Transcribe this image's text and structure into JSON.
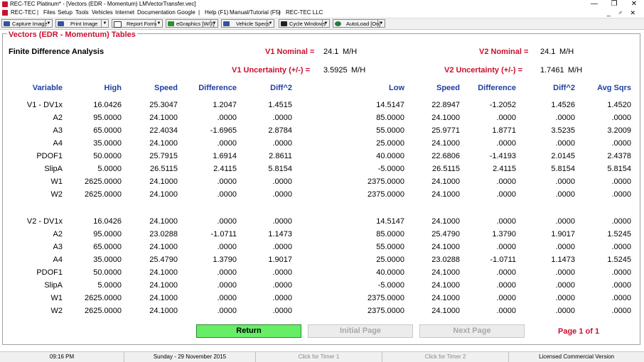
{
  "window": {
    "title": "REC-TEC Platinum* - [Vectors (EDR - Momentum)  LMVectorTransfer.vec]",
    "controls": {
      "minimize": "—",
      "maximize": "❐",
      "close": "✕"
    }
  },
  "menubar": {
    "items": [
      "REC-TEC",
      "|",
      "Files",
      "Setup",
      "Tools",
      "Vehicles",
      "Internet",
      "Documentation",
      "Google",
      "|",
      "Help (F1)",
      "Manual/Tutorial (F5)",
      "|",
      "REC-TEC LLC"
    ],
    "mdi_controls": "_ ♂ ✕"
  },
  "toolbar": {
    "capture": "Capture Image",
    "print": "Print Image",
    "report": "Report Form",
    "egraphics": "eGraphics [W/2]",
    "vehicle_specs": "Vehicle Specs",
    "cycle_windows": "Cycle Windows",
    "autoload": "AutoLoad [On]",
    "dropdown_arrow": "▼"
  },
  "panel": {
    "title": "Vectors (EDR - Momentum) Tables",
    "subtitle": "Finite Difference Analysis",
    "v1_nominal_label": "V1 Nominal =",
    "v1_nominal_value": "24.1",
    "v1_nominal_unit": "M/H",
    "v2_nominal_label": "V2 Nominal =",
    "v2_nominal_value": "24.1",
    "v2_nominal_unit": "M/H",
    "v1_unc_label": "V1 Uncertainty (+/-) =",
    "v1_unc_value": "3.5925",
    "v1_unc_unit": "M/H",
    "v2_unc_label": "V2 Uncertainty (+/-) =",
    "v2_unc_value": "1.7461",
    "v2_unc_unit": "M/H"
  },
  "columns": [
    "Variable",
    "High",
    "Speed",
    "Difference",
    "Diff^2",
    "Low",
    "Speed",
    "Difference",
    "Diff^2",
    "Avg Sqrs"
  ],
  "rows": [
    [
      "V1 - DV1x",
      "16.0426",
      "25.3047",
      "1.2047",
      "1.4515",
      "14.5147",
      "22.8947",
      "-1.2052",
      "1.4526",
      "1.4520"
    ],
    [
      "A2",
      "95.0000",
      "24.1000",
      ".0000",
      ".0000",
      "85.0000",
      "24.1000",
      ".0000",
      ".0000",
      ".0000"
    ],
    [
      "A3",
      "65.0000",
      "22.4034",
      "-1.6965",
      "2.8784",
      "55.0000",
      "25.9771",
      "1.8771",
      "3.5235",
      "3.2009"
    ],
    [
      "A4",
      "35.0000",
      "24.1000",
      ".0000",
      ".0000",
      "25.0000",
      "24.1000",
      ".0000",
      ".0000",
      ".0000"
    ],
    [
      "PDOF1",
      "50.0000",
      "25.7915",
      "1.6914",
      "2.8611",
      "40.0000",
      "22.6806",
      "-1.4193",
      "2.0145",
      "2.4378"
    ],
    [
      "SlipA",
      "5.0000",
      "26.5115",
      "2.4115",
      "5.8154",
      "-5.0000",
      "26.5115",
      "2.4115",
      "5.8154",
      "5.8154"
    ],
    [
      "W1",
      "2625.0000",
      "24.1000",
      ".0000",
      ".0000",
      "2375.0000",
      "24.1000",
      ".0000",
      ".0000",
      ".0000"
    ],
    [
      "W2",
      "2625.0000",
      "24.1000",
      ".0000",
      ".0000",
      "2375.0000",
      "24.1000",
      ".0000",
      ".0000",
      ".0000"
    ],
    [
      "V2 - DV1x",
      "16.0426",
      "24.1000",
      ".0000",
      ".0000",
      "14.5147",
      "24.1000",
      ".0000",
      ".0000",
      ".0000"
    ],
    [
      "A2",
      "95.0000",
      "23.0288",
      "-1.0711",
      "1.1473",
      "85.0000",
      "25.4790",
      "1.3790",
      "1.9017",
      "1.5245"
    ],
    [
      "A3",
      "65.0000",
      "24.1000",
      ".0000",
      ".0000",
      "55.0000",
      "24.1000",
      ".0000",
      ".0000",
      ".0000"
    ],
    [
      "A4",
      "35.0000",
      "25.4790",
      "1.3790",
      "1.9017",
      "25.0000",
      "23.0288",
      "-1.0711",
      "1.1473",
      "1.5245"
    ],
    [
      "PDOF1",
      "50.0000",
      "24.1000",
      ".0000",
      ".0000",
      "40.0000",
      "24.1000",
      ".0000",
      ".0000",
      ".0000"
    ],
    [
      "SlipA",
      "5.0000",
      "24.1000",
      ".0000",
      ".0000",
      "-5.0000",
      "24.1000",
      ".0000",
      ".0000",
      ".0000"
    ],
    [
      "W1",
      "2625.0000",
      "24.1000",
      ".0000",
      ".0000",
      "2375.0000",
      "24.1000",
      ".0000",
      ".0000",
      ".0000"
    ],
    [
      "W2",
      "2625.0000",
      "24.1000",
      ".0000",
      ".0000",
      "2375.0000",
      "24.1000",
      ".0000",
      ".0000",
      ".0000"
    ]
  ],
  "buttons": {
    "return": "Return",
    "initial_page": "Initial Page",
    "next_page": "Next Page",
    "page_info": "Page 1 of 1"
  },
  "status": {
    "time": "09:16 PM",
    "date": "Sunday  -  29 November 2015",
    "timer1": "Click for Timer 1",
    "timer2": "Click for Timer 2",
    "license": "Licensed Commercial Version"
  }
}
